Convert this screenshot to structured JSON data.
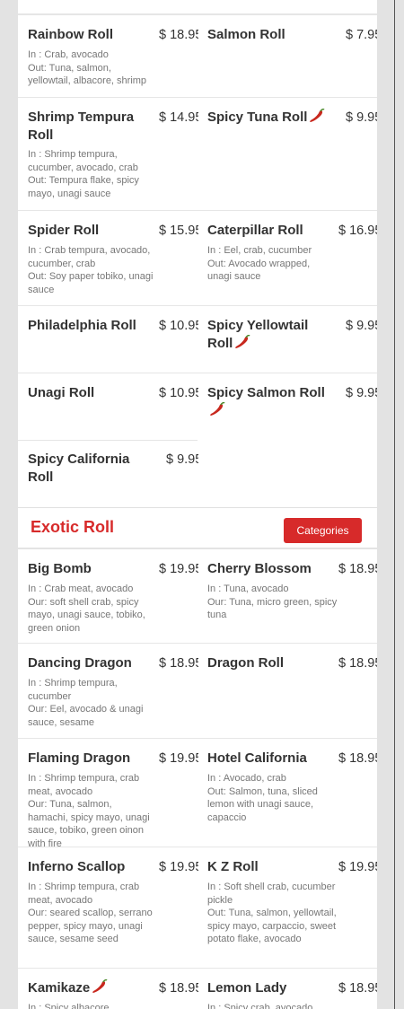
{
  "rows_top": [
    {
      "items": [
        {
          "name": "Rainbow Roll",
          "price": "$ 18.95",
          "chili": false,
          "desc": [
            "In : Crab, avocado",
            "Out: Tuna, salmon, yellowtail, albacore, shrimp"
          ]
        },
        {
          "name": "Salmon Roll",
          "price": "$ 7.95",
          "chili": false,
          "desc": []
        }
      ]
    },
    {
      "items": [
        {
          "name": "Shrimp Tempura Roll",
          "price": "$ 14.95",
          "chili": false,
          "desc": [
            "In : Shrimp tempura, cucumber, avocado, crab",
            "Out: Tempura flake, spicy mayo, unagi sauce"
          ]
        },
        {
          "name": "Spicy Tuna Roll",
          "price": "$ 9.95",
          "chili": true,
          "desc": []
        }
      ]
    },
    {
      "items": [
        {
          "name": "Spider Roll",
          "price": "$ 15.95",
          "chili": false,
          "desc": [
            "In : Crab tempura, avocado, cucumber, crab",
            "Out: Soy paper tobiko, unagi sauce"
          ]
        },
        {
          "name": "Caterpillar Roll",
          "price": "$ 16.95",
          "chili": false,
          "desc": [
            "In : Eel, crab, cucumber",
            "Out: Avocado wrapped, unagi sauce"
          ]
        }
      ]
    },
    {
      "items": [
        {
          "name": "Philadelphia Roll",
          "price": "$ 10.95",
          "chili": false,
          "desc": []
        },
        {
          "name": "Spicy Yellowtail Roll",
          "price": "$ 9.95",
          "chili": true,
          "desc": []
        }
      ]
    },
    {
      "items": [
        {
          "name": "Unagi Roll",
          "price": "$ 10.95",
          "chili": false,
          "desc": []
        },
        {
          "name": "Spicy Salmon Roll",
          "price": "$ 9.95",
          "chili": true,
          "desc": []
        }
      ]
    },
    {
      "items": [
        {
          "name": "Spicy California Roll",
          "price": "$ 9.95",
          "chili": false,
          "desc": []
        }
      ]
    }
  ],
  "section": {
    "title": "Exotic Roll",
    "button_label": "Categories"
  },
  "rows_exotic": [
    {
      "items": [
        {
          "name": "Big Bomb",
          "price": "$ 19.95",
          "chili": false,
          "desc": [
            "In : Crab meat, avocado",
            "Our: soft shell crab, spicy mayo, unagi sauce, tobiko, green onion"
          ]
        },
        {
          "name": "Cherry Blossom",
          "price": "$ 18.95",
          "chili": false,
          "desc": [
            "In : Tuna, avocado",
            "Our: Tuna, micro green, spicy tuna"
          ]
        }
      ]
    },
    {
      "items": [
        {
          "name": "Dancing Dragon",
          "price": "$ 18.95",
          "chili": false,
          "desc": [
            "In : Shrimp tempura, cucumber",
            "Our: Eel, avocado & unagi sauce, sesame"
          ]
        },
        {
          "name": "Dragon Roll",
          "price": "$ 18.95",
          "chili": false,
          "desc": []
        }
      ]
    },
    {
      "items": [
        {
          "name": "Flaming Dragon",
          "price": "$ 19.95",
          "chili": false,
          "desc": [
            "In : Shrimp tempura, crab meat, avocado",
            "Our: Tuna, salmon, hamachi, spicy mayo, unagi sauce, tobiko, green oinon with fire"
          ]
        },
        {
          "name": "Hotel California",
          "price": "$ 18.95",
          "chili": false,
          "desc": [
            "In : Avocado, crab",
            "Out: Salmon, tuna, sliced lemon with unagi sauce, capaccio"
          ]
        }
      ]
    },
    {
      "items": [
        {
          "name": "Inferno Scallop",
          "price": "$ 19.95",
          "chili": false,
          "desc": [
            "In : Shrimp tempura, crab meat, avocado",
            "Our: seared scallop, serrano pepper, spicy mayo, unagi sauce, sesame seed"
          ]
        },
        {
          "name": "K Z Roll",
          "price": "$ 19.95",
          "chili": false,
          "desc": [
            "In : Soft shell crab, cucumber pickle",
            "Out: Tuna, salmon, yellowtail, spicy mayo, carpaccio, sweet potato flake, avocado"
          ]
        }
      ]
    },
    {
      "items": [
        {
          "name": "Kamikaze",
          "price": "$ 18.95",
          "chili": true,
          "desc": [
            "In : Spicy albacore, cucumber"
          ]
        },
        {
          "name": "Lemon Lady",
          "price": "$ 18.95",
          "chili": false,
          "desc": [
            "In : Spicy crab, avocado"
          ]
        }
      ]
    }
  ],
  "colors": {
    "accent": "#d72a2a",
    "chili": "#c8281e"
  },
  "icons": {
    "chili": "chili-pepper-icon"
  }
}
